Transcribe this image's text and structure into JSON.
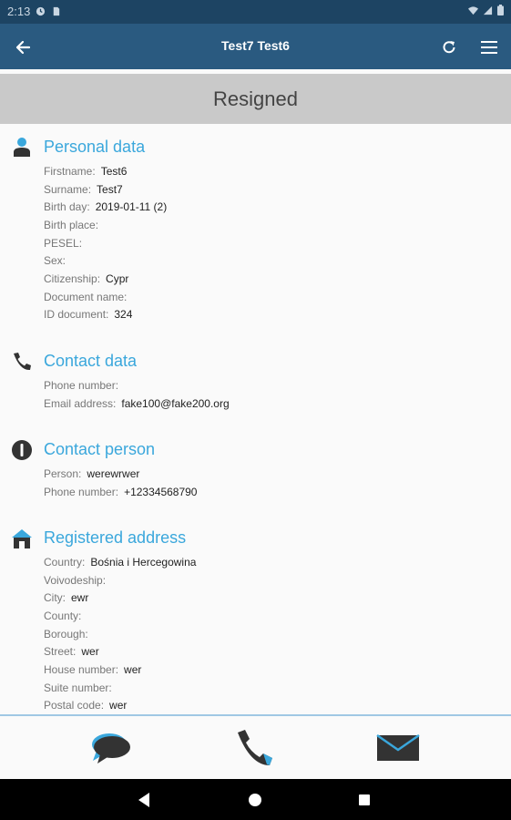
{
  "status_bar": {
    "time": "2:13"
  },
  "app_bar": {
    "title": "Test7 Test6"
  },
  "banner": {
    "status": "Resigned"
  },
  "sections": {
    "personal": {
      "title": "Personal data",
      "rows": [
        {
          "label": "Firstname:",
          "value": "Test6"
        },
        {
          "label": "Surname:",
          "value": "Test7"
        },
        {
          "label": "Birth day:",
          "value": "2019-01-11 (2)"
        },
        {
          "label": "Birth place:",
          "value": ""
        },
        {
          "label": "PESEL:",
          "value": ""
        },
        {
          "label": "Sex:",
          "value": ""
        },
        {
          "label": "Citizenship:",
          "value": "Cypr"
        },
        {
          "label": "Document name:",
          "value": ""
        },
        {
          "label": "ID document:",
          "value": "324"
        }
      ]
    },
    "contact": {
      "title": "Contact data",
      "rows": [
        {
          "label": "Phone number:",
          "value": ""
        },
        {
          "label": "Email address:",
          "value": "fake100@fake200.org"
        }
      ]
    },
    "contact_person": {
      "title": "Contact person",
      "rows": [
        {
          "label": "Person:",
          "value": "werewrwer"
        },
        {
          "label": "Phone number:",
          "value": "+12334568790"
        }
      ]
    },
    "address": {
      "title": "Registered address",
      "rows": [
        {
          "label": "Country:",
          "value": "Bośnia i Hercegowina"
        },
        {
          "label": "Voivodeship:",
          "value": ""
        },
        {
          "label": "City:",
          "value": "ewr"
        },
        {
          "label": "County:",
          "value": ""
        },
        {
          "label": "Borough:",
          "value": ""
        },
        {
          "label": "Street:",
          "value": "wer"
        },
        {
          "label": "House number:",
          "value": "wer"
        },
        {
          "label": "Suite number:",
          "value": ""
        },
        {
          "label": "Postal code:",
          "value": "wer"
        }
      ]
    }
  },
  "icons": {
    "back": "arrow-left-icon",
    "refresh": "refresh-icon",
    "menu": "hamburger-menu-icon",
    "personal": "person-icon",
    "contact": "phone-icon",
    "contact_person": "info-icon",
    "address": "house-icon",
    "bottom_message": "chat-bubble-icon",
    "bottom_call": "phone-icon",
    "bottom_email": "envelope-icon"
  },
  "colors": {
    "app_bar": "#2a5a80",
    "status_bar": "#1d4463",
    "accent": "#3aa7dc",
    "banner": "#c9c9c9",
    "nav_bar": "#000000"
  }
}
